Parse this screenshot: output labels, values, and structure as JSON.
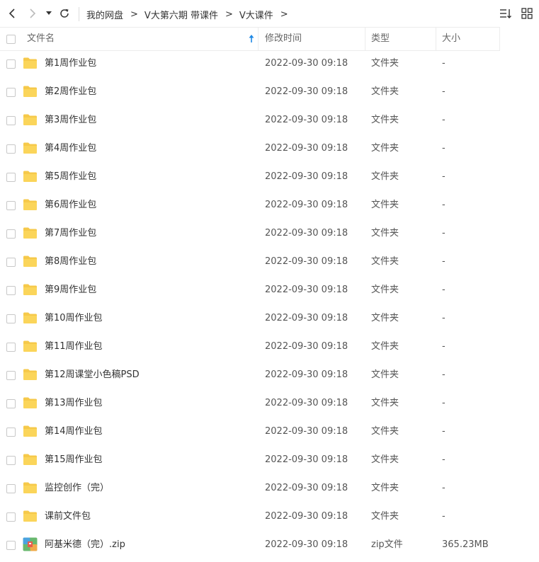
{
  "toolbar": {
    "breadcrumb": [
      "我的网盘",
      "V大第六期 带课件",
      "V大课件"
    ],
    "breadcrumb_separator": ">",
    "icons": [
      "back-icon",
      "forward-icon",
      "dropdown-icon",
      "refresh-icon",
      "sort-icon",
      "grid-view-icon"
    ]
  },
  "header": {
    "name": "文件名",
    "modified": "修改时间",
    "type": "类型",
    "size": "大小",
    "sort_icon": "arrow-up-icon"
  },
  "colors": {
    "folder": "#f6c94a",
    "accent": "#1e88e5"
  },
  "files": [
    {
      "name": "第1周作业包",
      "modified": "2022-09-30 09:18",
      "type": "文件夹",
      "size": "-",
      "icon": "folder-icon"
    },
    {
      "name": "第2周作业包",
      "modified": "2022-09-30 09:18",
      "type": "文件夹",
      "size": "-",
      "icon": "folder-icon"
    },
    {
      "name": "第3周作业包",
      "modified": "2022-09-30 09:18",
      "type": "文件夹",
      "size": "-",
      "icon": "folder-icon"
    },
    {
      "name": "第4周作业包",
      "modified": "2022-09-30 09:18",
      "type": "文件夹",
      "size": "-",
      "icon": "folder-icon"
    },
    {
      "name": "第5周作业包",
      "modified": "2022-09-30 09:18",
      "type": "文件夹",
      "size": "-",
      "icon": "folder-icon"
    },
    {
      "name": "第6周作业包",
      "modified": "2022-09-30 09:18",
      "type": "文件夹",
      "size": "-",
      "icon": "folder-icon"
    },
    {
      "name": "第7周作业包",
      "modified": "2022-09-30 09:18",
      "type": "文件夹",
      "size": "-",
      "icon": "folder-icon"
    },
    {
      "name": "第8周作业包",
      "modified": "2022-09-30 09:18",
      "type": "文件夹",
      "size": "-",
      "icon": "folder-icon"
    },
    {
      "name": "第9周作业包",
      "modified": "2022-09-30 09:18",
      "type": "文件夹",
      "size": "-",
      "icon": "folder-icon"
    },
    {
      "name": "第10周作业包",
      "modified": "2022-09-30 09:18",
      "type": "文件夹",
      "size": "-",
      "icon": "folder-icon"
    },
    {
      "name": "第11周作业包",
      "modified": "2022-09-30 09:18",
      "type": "文件夹",
      "size": "-",
      "icon": "folder-icon"
    },
    {
      "name": "第12周课堂小色稿PSD",
      "modified": "2022-09-30 09:18",
      "type": "文件夹",
      "size": "-",
      "icon": "folder-icon"
    },
    {
      "name": "第13周作业包",
      "modified": "2022-09-30 09:18",
      "type": "文件夹",
      "size": "-",
      "icon": "folder-icon"
    },
    {
      "name": "第14周作业包",
      "modified": "2022-09-30 09:18",
      "type": "文件夹",
      "size": "-",
      "icon": "folder-icon"
    },
    {
      "name": "第15周作业包",
      "modified": "2022-09-30 09:18",
      "type": "文件夹",
      "size": "-",
      "icon": "folder-icon"
    },
    {
      "name": "监控创作（完）",
      "modified": "2022-09-30 09:18",
      "type": "文件夹",
      "size": "-",
      "icon": "folder-icon"
    },
    {
      "name": "课前文件包",
      "modified": "2022-09-30 09:18",
      "type": "文件夹",
      "size": "-",
      "icon": "folder-icon"
    },
    {
      "name": "阿基米德（完）.zip",
      "modified": "2022-09-30 09:18",
      "type": "zip文件",
      "size": "365.23MB",
      "icon": "zip-file-icon"
    }
  ]
}
